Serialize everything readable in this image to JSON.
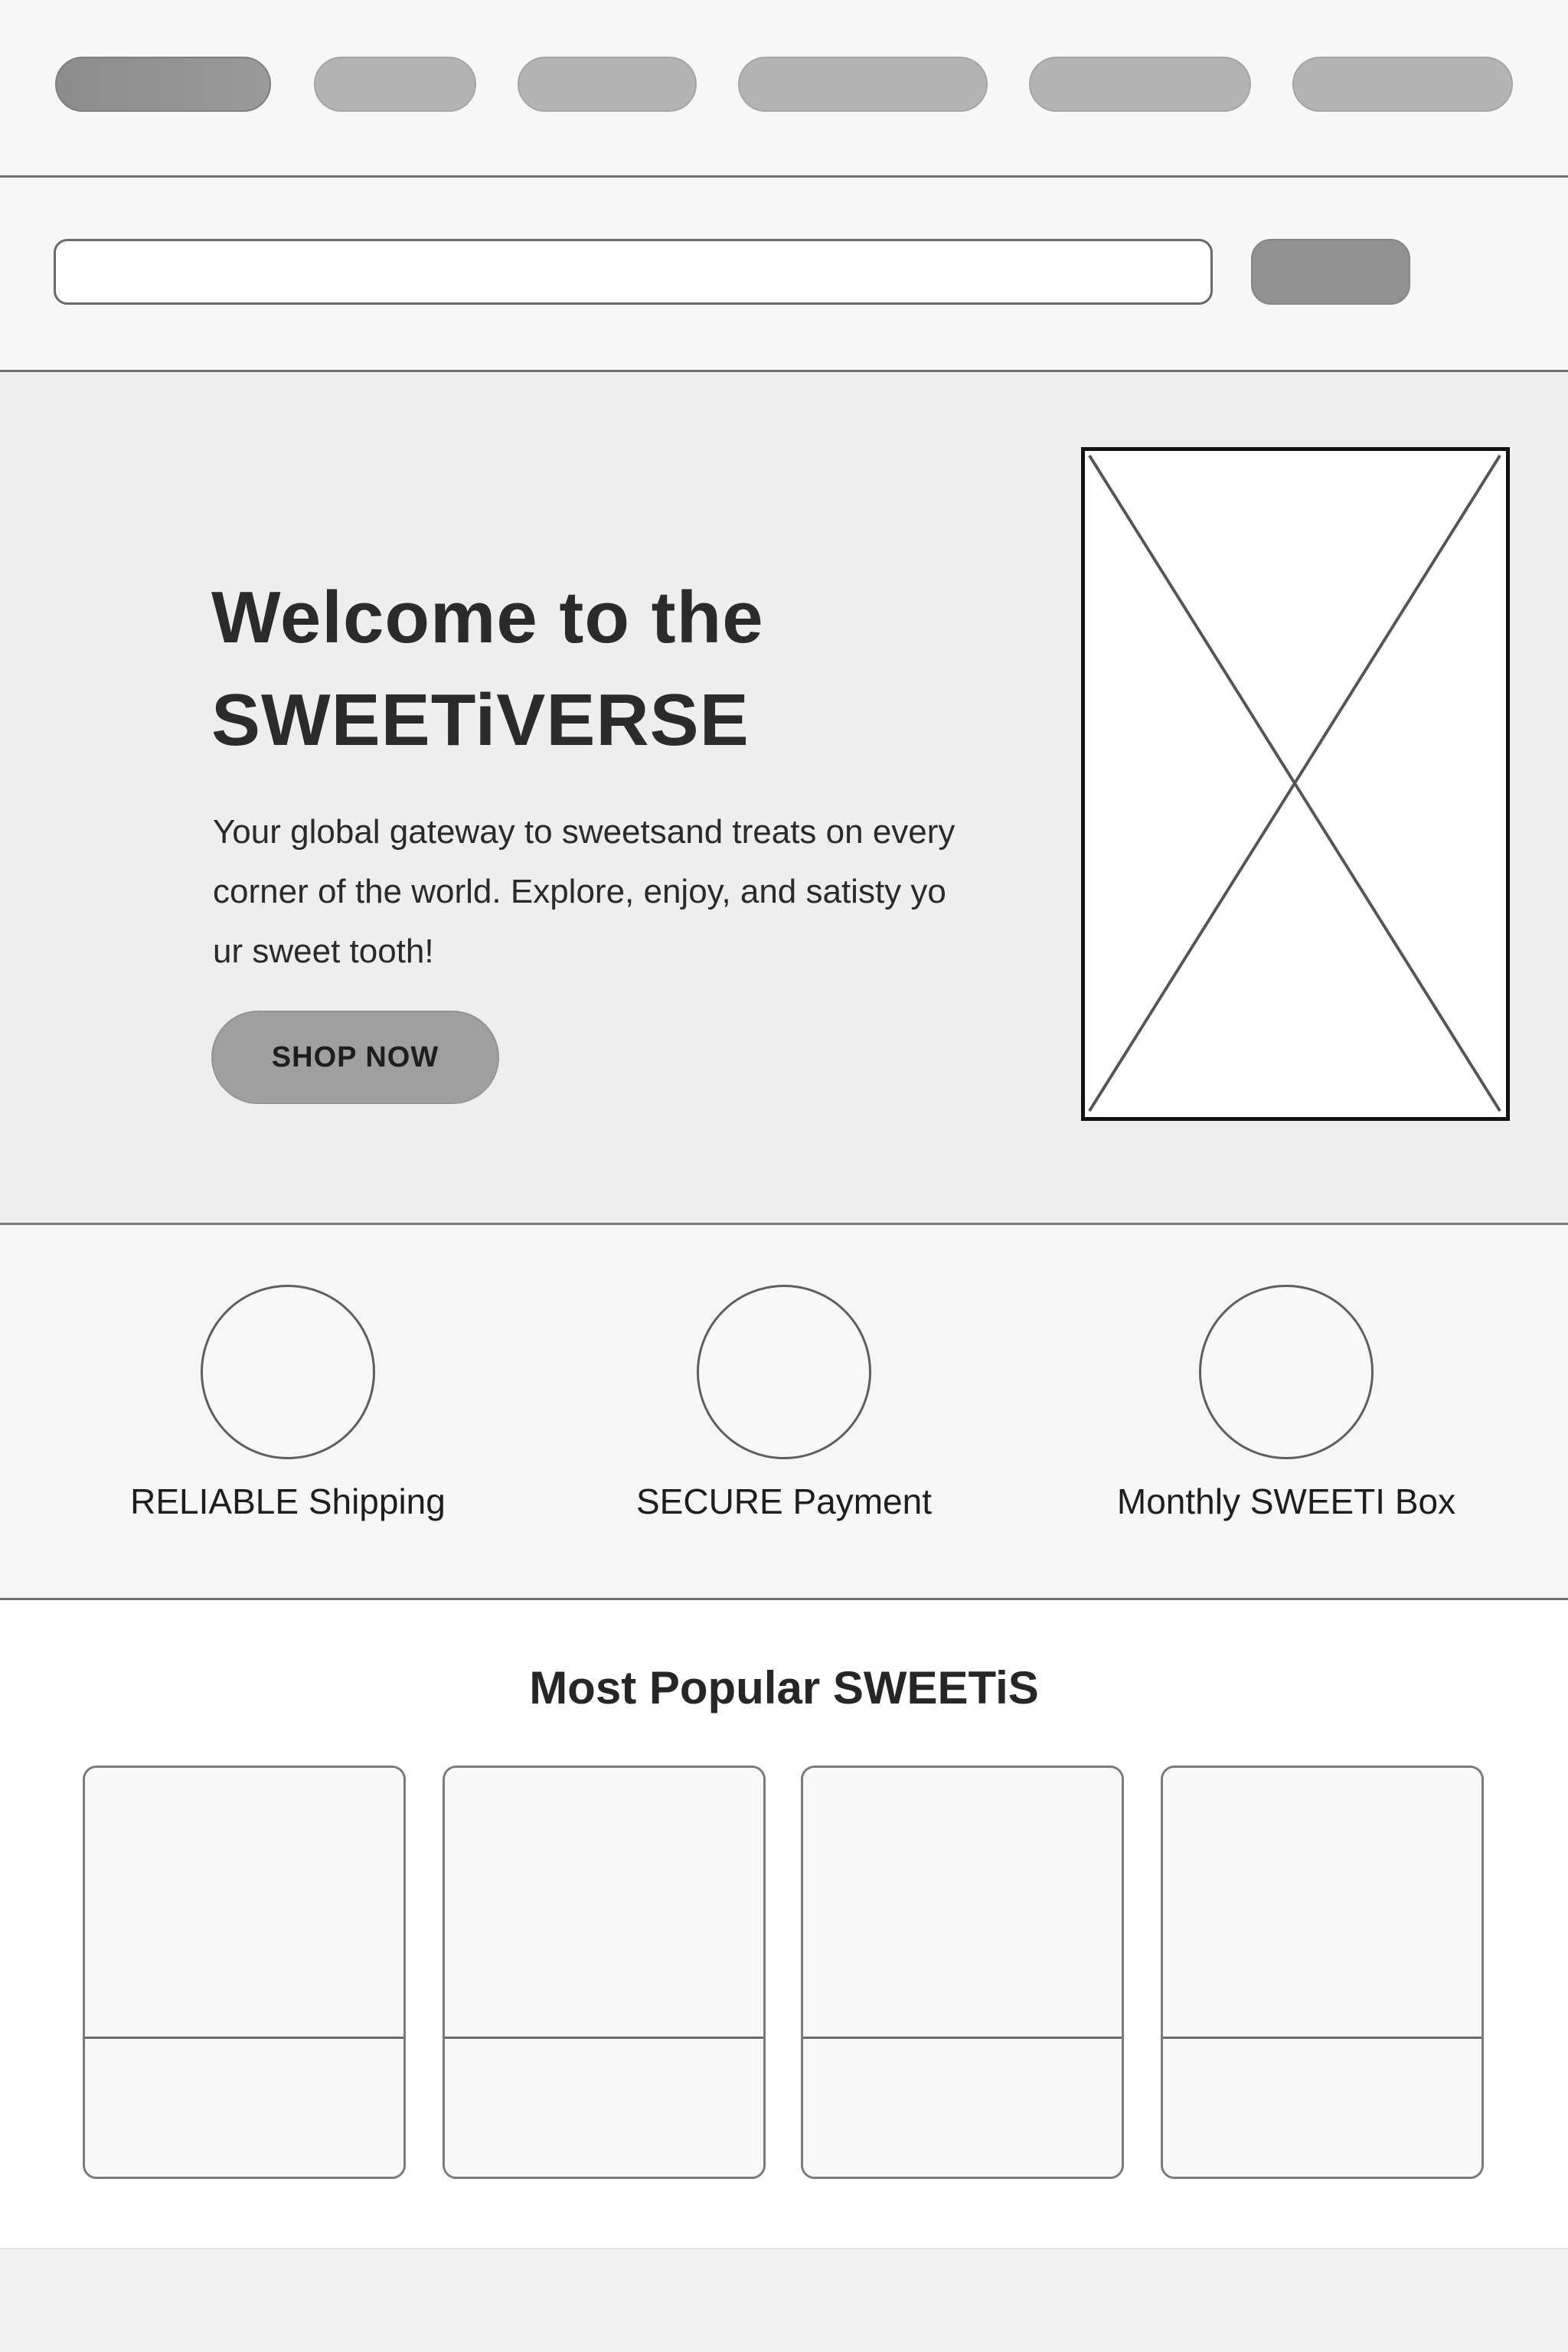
{
  "nav": {
    "items": [
      {
        "icon": "nav-placeholder",
        "state": "active"
      },
      {
        "icon": "nav-placeholder",
        "state": "default"
      },
      {
        "icon": "nav-placeholder",
        "state": "default"
      },
      {
        "icon": "nav-placeholder",
        "state": "default"
      },
      {
        "icon": "nav-placeholder",
        "state": "default"
      },
      {
        "icon": "nav-placeholder",
        "state": "default"
      }
    ]
  },
  "search": {
    "placeholder": "",
    "value": "",
    "button_label": ""
  },
  "hero": {
    "title_line1": "Welcome to the",
    "title_line2": "SWEETiVERSE",
    "text_line1": "Your global gateway to sweetsand treats on every",
    "text_line2": "corner of the world. Explore, enjoy, and satisty yo",
    "text_line3": "ur sweet tooth!",
    "cta_label": "SHOP NOW",
    "image_icon": "image-placeholder-icon"
  },
  "features": [
    {
      "label": "RELIABLE Shipping",
      "icon": "shipping-icon"
    },
    {
      "label": "SECURE Payment",
      "icon": "payment-icon"
    },
    {
      "label": "Monthly SWEETI Box",
      "icon": "box-icon"
    }
  ],
  "popular": {
    "title": "Most Popular SWEETiS",
    "products": [
      {
        "icon": "product-image-placeholder"
      },
      {
        "icon": "product-image-placeholder"
      },
      {
        "icon": "product-image-placeholder"
      },
      {
        "icon": "product-image-placeholder"
      }
    ]
  },
  "colors": {
    "background": "#f7f7f7",
    "hero_background": "#eeeeee",
    "pill": "#b3b3b3",
    "pill_active": "#8c8c8c",
    "button": "#9f9f9f",
    "text": "#222222",
    "border": "#6f6f6f"
  }
}
